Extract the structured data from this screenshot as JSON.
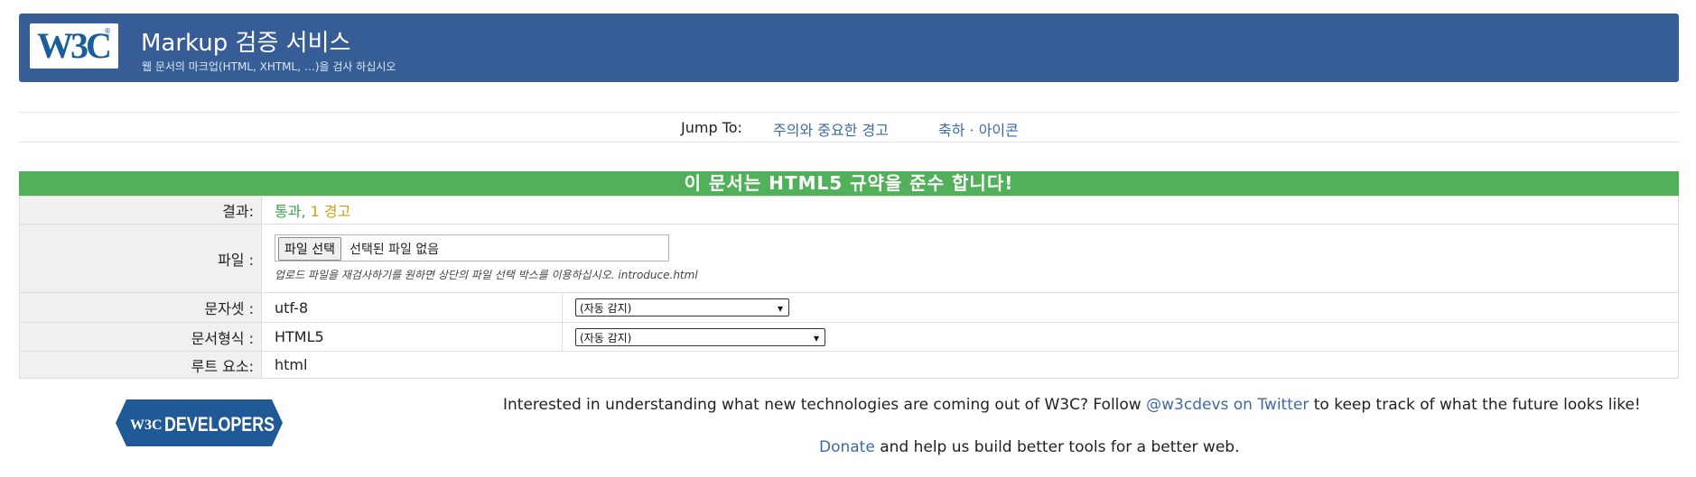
{
  "header": {
    "logo_text": "W3C",
    "title": "Markup 검증 서비스",
    "subtitle": "웹 문서의 마크업(HTML, XHTML, …)을 검사 하십시오"
  },
  "jump": {
    "label": "Jump To:",
    "links": [
      "주의와 중요한 경고",
      "축하 · 아이콘"
    ]
  },
  "result": {
    "heading": "이 문서는 HTML5 규약을 준수 합니다!",
    "rows": {
      "result_label": "결과:",
      "result_pass": "통과,",
      "result_warn": "1 경고",
      "file_label": "파일 :",
      "file_button": "파일 선택",
      "file_none": "선택된 파일 없음",
      "file_note": "업로드 파일을 재검사하기를 원하면 상단의 파일 선택 박스를 이용하십시오. introduce.html",
      "charset_label": "문자셋 :",
      "charset_value": "utf-8",
      "charset_select": "(자동 감지)",
      "doctype_label": "문서형식 :",
      "doctype_value": "HTML5",
      "doctype_select": "(자동 감지)",
      "root_label": "루트 요소:",
      "root_value": "html"
    }
  },
  "footer": {
    "badge_small": "W3C",
    "badge_big": "DEVELOPERS",
    "line1_pre": "Interested in understanding what new technologies are coming out of W3C? Follow",
    "line1_link": "@w3cdevs on Twitter",
    "line1_post": "to keep track of what the future looks like!",
    "line2_link": "Donate",
    "line2_post": "and help us build better tools for a better web."
  },
  "colors": {
    "banner": "#365d95",
    "pass_banner": "#52b05a",
    "link": "#3d6aa3",
    "warning": "#c9a014",
    "badge": "#1f5a96"
  }
}
